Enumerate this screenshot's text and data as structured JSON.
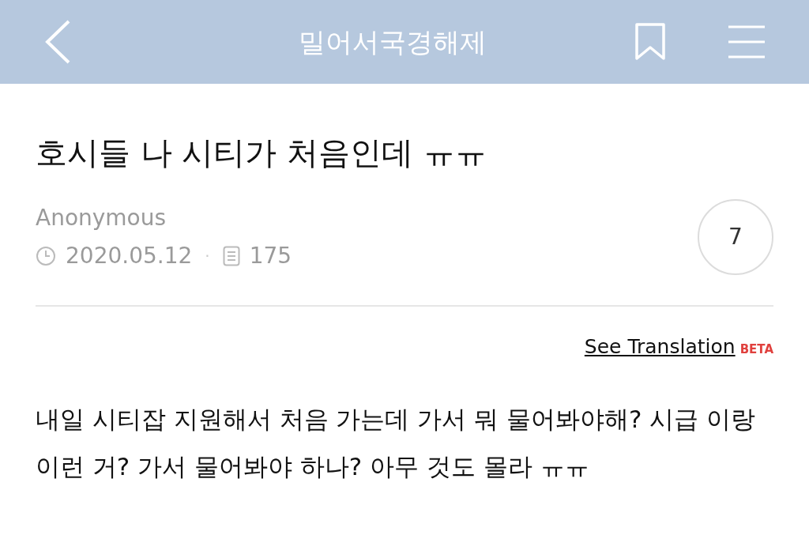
{
  "header": {
    "title": "밀어서국경해제"
  },
  "post": {
    "title": "호시들 나 시티가 처음인데 ㅠㅠ",
    "author": "Anonymous",
    "date": "2020.05.12",
    "separator": "·",
    "views": "175",
    "count": "7"
  },
  "translation": {
    "link": "See Translation",
    "badge": "BETA"
  },
  "body": "내일 시티잡 지원해서 처음 가는데 가서 뭐 물어봐야해? 시급 이랑 이런 거? 가서 물어봐야 하나? 아무 것도 몰라 ㅠㅠ"
}
